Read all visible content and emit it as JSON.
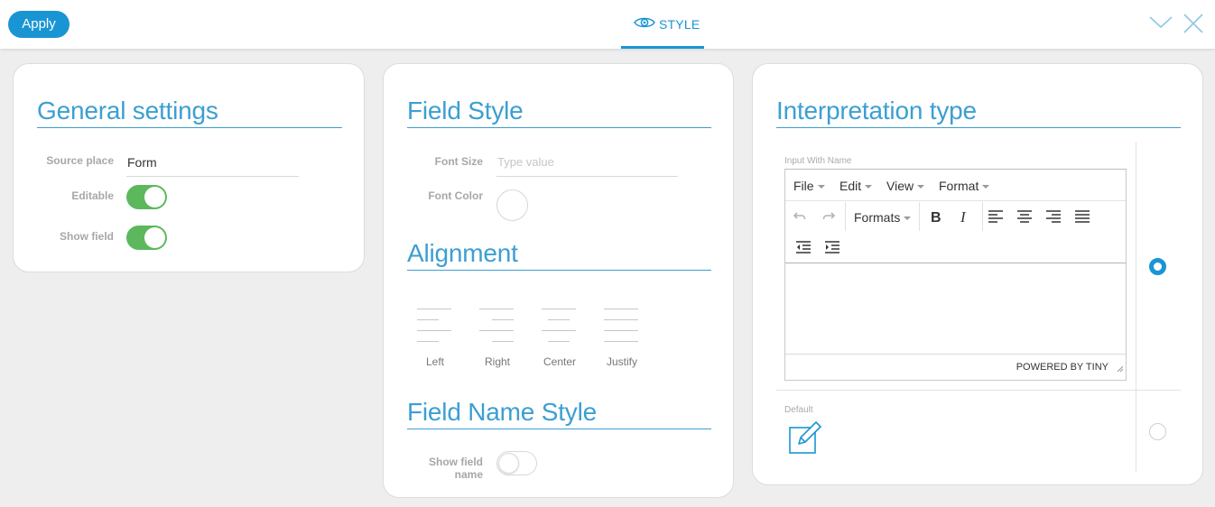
{
  "header": {
    "apply_label": "Apply",
    "tab_label": "STYLE",
    "icons": [
      "eye-icon",
      "chevron-down-icon",
      "close-icon"
    ]
  },
  "general": {
    "title": "General settings",
    "source_place_label": "Source place",
    "source_place_value": "Form",
    "editable_label": "Editable",
    "editable_on": true,
    "show_field_label": "Show field",
    "show_field_on": true
  },
  "field_style": {
    "title": "Field Style",
    "font_size_label": "Font Size",
    "font_size_placeholder": "Type value",
    "font_color_label": "Font Color",
    "alignment_title": "Alignment",
    "alignment_options": [
      "Left",
      "Right",
      "Center",
      "Justify"
    ],
    "field_name_style_title": "Field Name Style",
    "show_field_name_label_1": "Show field",
    "show_field_name_label_2": "name",
    "show_field_name_on": false
  },
  "interpretation": {
    "title": "Interpretation type",
    "option1_label": "Input With Name",
    "option1_selected": true,
    "menu": [
      "File",
      "Edit",
      "View",
      "Format"
    ],
    "formats_label": "Formats",
    "powered_by": "POWERED BY TINY",
    "toolbar_icons": [
      "undo-icon",
      "redo-icon",
      "bold-icon",
      "italic-icon",
      "align-left-icon",
      "align-center-icon",
      "align-right-icon",
      "align-justify-icon",
      "outdent-icon",
      "indent-icon"
    ],
    "option2_label": "Default",
    "option2_selected": false
  },
  "colors": {
    "accent": "#1a95d4",
    "title_blue": "#3c9fd1",
    "toggle_on": "#5cb85c"
  }
}
